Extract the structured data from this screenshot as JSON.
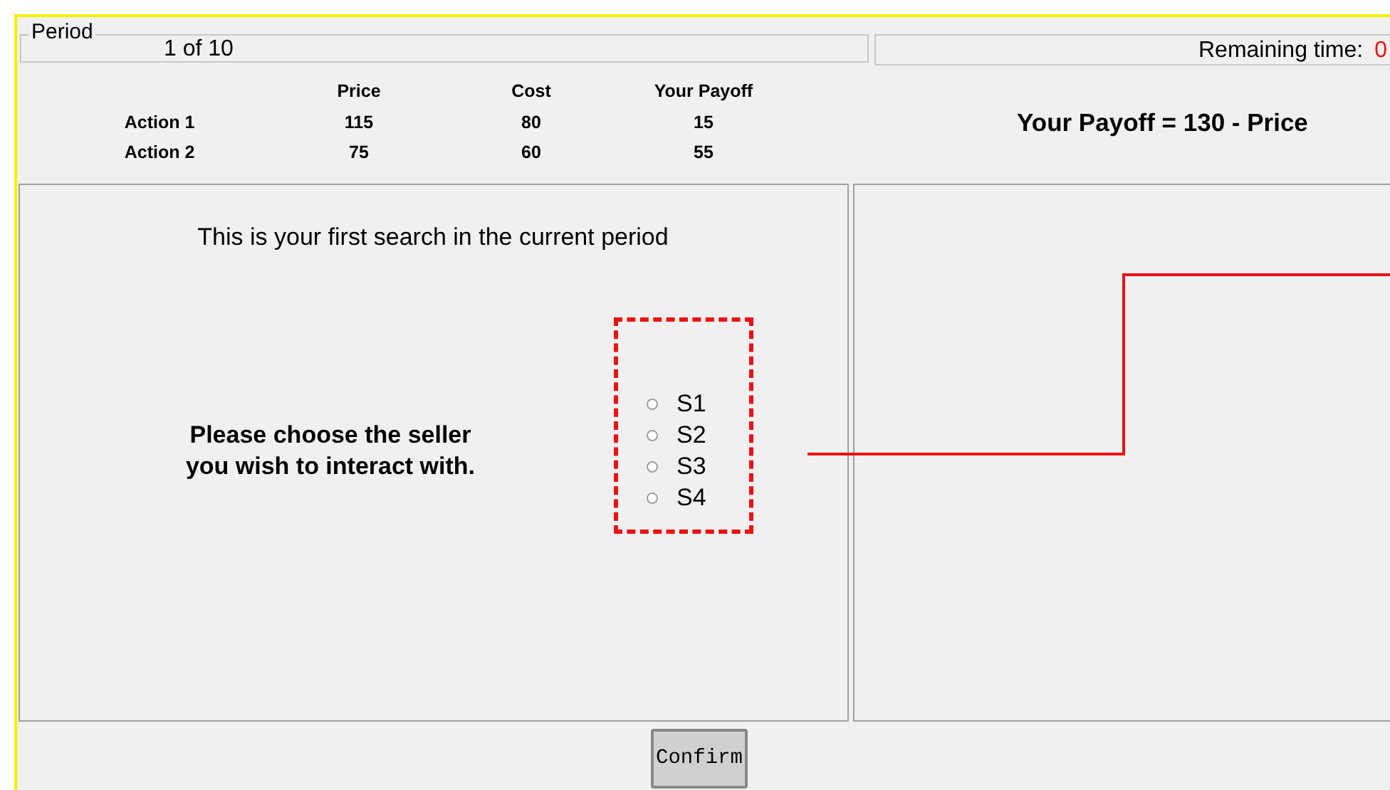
{
  "period": {
    "legend": "Period",
    "value": "1 of 10"
  },
  "remaining_time": {
    "label": "Remaining time:",
    "value": "0"
  },
  "payoff_table": {
    "columns": [
      "Price",
      "Cost",
      "Your Payoff"
    ],
    "rows": [
      {
        "label": "Action 1",
        "cells": [
          "115",
          "80",
          "15"
        ]
      },
      {
        "label": "Action 2",
        "cells": [
          "75",
          "60",
          "55"
        ]
      }
    ]
  },
  "formula": "Your Payoff = 130 - Price",
  "message": "This is your first search in the current period",
  "prompt": "Please choose the seller you wish to interact with.",
  "sellers": [
    {
      "label": "S1",
      "selected": false
    },
    {
      "label": "S2",
      "selected": false
    },
    {
      "label": "S3",
      "selected": false
    },
    {
      "label": "S4",
      "selected": false
    }
  ],
  "confirm_button": "Confirm"
}
